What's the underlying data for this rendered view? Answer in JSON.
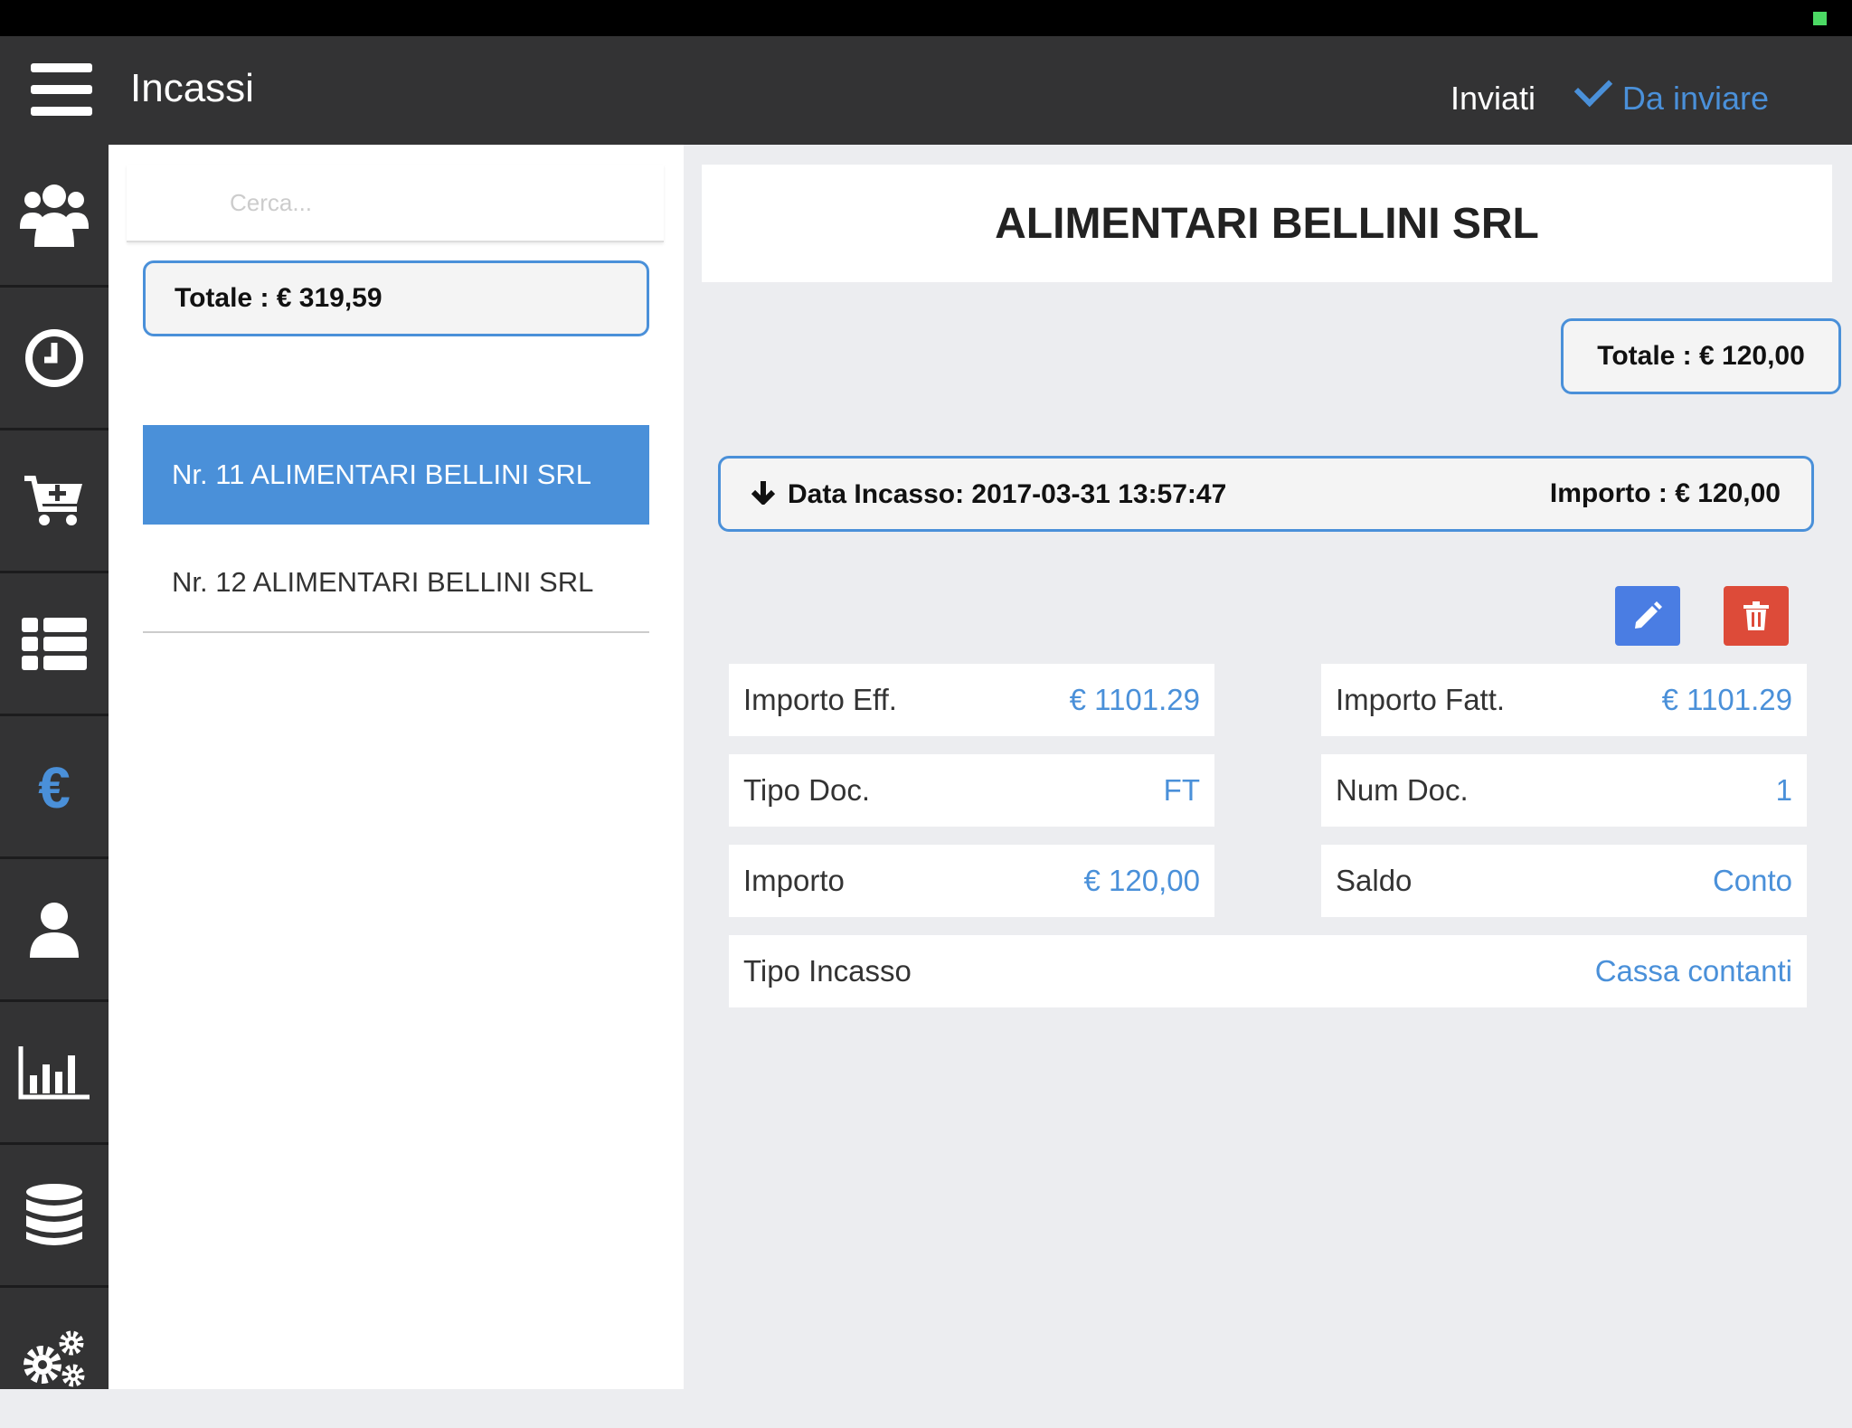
{
  "header": {
    "title": "Incassi",
    "tab_inviati": "Inviati",
    "tab_da_inviare": "Da inviare",
    "active_tab": "Da inviare"
  },
  "sidebar": {
    "items": [
      {
        "icon": "users-icon"
      },
      {
        "icon": "clock-icon"
      },
      {
        "icon": "cart-plus-icon"
      },
      {
        "icon": "list-icon"
      },
      {
        "icon": "euro-icon",
        "active": true
      },
      {
        "icon": "user-icon"
      },
      {
        "icon": "bar-chart-icon"
      },
      {
        "icon": "database-icon"
      },
      {
        "icon": "gears-icon"
      }
    ]
  },
  "list": {
    "search_placeholder": "Cerca...",
    "total": "Totale : € 319,59",
    "items": [
      {
        "label": "Nr. 11 ALIMENTARI BELLINI SRL",
        "selected": true
      },
      {
        "label": "Nr. 12 ALIMENTARI BELLINI SRL",
        "selected": false
      }
    ]
  },
  "detail": {
    "client": "ALIMENTARI BELLINI SRL",
    "total": "Totale : € 120,00",
    "incasso": {
      "date": "Data Incasso: 2017-03-31 13:57:47",
      "amount": "Importo : € 120,00"
    },
    "fields": {
      "importo_eff": {
        "label": "Importo Eff.",
        "value": "€ 1101.29"
      },
      "importo_fatt": {
        "label": "Importo Fatt.",
        "value": "€ 1101.29"
      },
      "tipo_doc": {
        "label": "Tipo Doc.",
        "value": "FT"
      },
      "num_doc": {
        "label": "Num Doc.",
        "value": "1"
      },
      "importo": {
        "label": "Importo",
        "value": "€ 120,00"
      },
      "saldo": {
        "label": "Saldo",
        "value": "Conto"
      },
      "tipo_incasso": {
        "label": "Tipo Incasso",
        "value": "Cassa contanti"
      }
    }
  },
  "colors": {
    "accent": "#4a90d9",
    "header_bg": "#333334",
    "edit_button": "#4a7de3",
    "delete_button": "#dd4b39"
  }
}
